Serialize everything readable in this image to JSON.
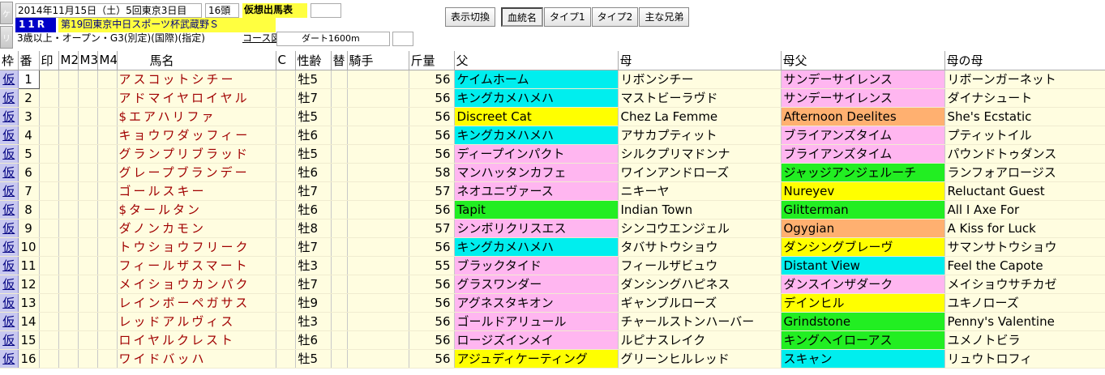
{
  "header": {
    "date": "2014年11月15日（土）5回東京3日目",
    "heads": "16頭",
    "badge": "仮想出馬表",
    "race_no": "11R",
    "race_name": "第19回東京中日スポーツ杯武蔵野Ｓ",
    "conditions": "3歳以上・オープン・G3(別定)(国際)(指定)",
    "course_label": "コース図",
    "course": "ダート1600m"
  },
  "side_buttons": [
    "ケ",
    "リ"
  ],
  "toolbar": {
    "buttons": [
      "表示切換",
      "血統名",
      "タイプ1",
      "タイプ2",
      "主な兄弟"
    ],
    "active_index": 1
  },
  "columns": [
    "枠",
    "番",
    "印",
    "M2",
    "M3",
    "M4",
    "馬名",
    "C",
    "性齢",
    "替",
    "騎手",
    "斤量",
    "父",
    "母",
    "母父",
    "母の母"
  ],
  "colors": {
    "cyan": "#00eeee",
    "pink": "#ffb6f0",
    "yellow": "#ffff00",
    "green": "#22ee22",
    "orange": "#ffb070",
    "row_bg": "#fffde0",
    "waku": "#c8c8f0"
  },
  "rows": [
    {
      "waku": "仮",
      "num": "1",
      "name": "アスコットシチー",
      "sex_age": "牡5",
      "kin": "56",
      "sire": "ケイムホーム",
      "sire_c": "cyan",
      "dam": "リボンシチー",
      "dam_c": "",
      "bms": "サンデーサイレンス",
      "bms_c": "pink",
      "dd": "リボーンガーネット",
      "dd_c": ""
    },
    {
      "waku": "仮",
      "num": "2",
      "name": "アドマイヤロイヤル",
      "sex_age": "牡7",
      "kin": "56",
      "sire": "キングカメハメハ",
      "sire_c": "cyan",
      "dam": "マストビーラヴド",
      "dam_c": "",
      "bms": "サンデーサイレンス",
      "bms_c": "pink",
      "dd": "ダイナシュート",
      "dd_c": ""
    },
    {
      "waku": "仮",
      "num": "3",
      "name": "$エアハリファ",
      "sex_age": "牡5",
      "kin": "56",
      "sire": "Discreet Cat",
      "sire_c": "yellow",
      "dam": "Chez La Femme",
      "dam_c": "",
      "bms": "Afternoon Deelites",
      "bms_c": "orange",
      "dd": "She's Ecstatic",
      "dd_c": ""
    },
    {
      "waku": "仮",
      "num": "4",
      "name": "キョウワダッフィー",
      "sex_age": "牡6",
      "kin": "56",
      "sire": "キングカメハメハ",
      "sire_c": "cyan",
      "dam": "アサカプティット",
      "dam_c": "",
      "bms": "ブライアンズタイム",
      "bms_c": "pink",
      "dd": "プティットイル",
      "dd_c": ""
    },
    {
      "waku": "仮",
      "num": "5",
      "name": "グランプリブラッド",
      "sex_age": "牡5",
      "kin": "56",
      "sire": "ディープインパクト",
      "sire_c": "pink",
      "dam": "シルクプリマドンナ",
      "dam_c": "",
      "bms": "ブライアンズタイム",
      "bms_c": "pink",
      "dd": "パウンドトゥダンス",
      "dd_c": ""
    },
    {
      "waku": "仮",
      "num": "6",
      "name": "グレープブランデー",
      "sex_age": "牡6",
      "kin": "58",
      "sire": "マンハッタンカフェ",
      "sire_c": "pink",
      "dam": "ワインアンドローズ",
      "dam_c": "",
      "bms": "ジャッジアンジェルーチ",
      "bms_c": "green",
      "dd": "ランフォアロージス",
      "dd_c": ""
    },
    {
      "waku": "仮",
      "num": "7",
      "name": "ゴールスキー",
      "sex_age": "牡7",
      "kin": "57",
      "sire": "ネオユニヴァース",
      "sire_c": "pink",
      "dam": "ニキーヤ",
      "dam_c": "",
      "bms": "Nureyev",
      "bms_c": "yellow",
      "dd": "Reluctant Guest",
      "dd_c": ""
    },
    {
      "waku": "仮",
      "num": "8",
      "name": "$タールタン",
      "sex_age": "牡6",
      "kin": "56",
      "sire": "Tapit",
      "sire_c": "green",
      "dam": "Indian Town",
      "dam_c": "",
      "bms": "Glitterman",
      "bms_c": "green",
      "dd": "All I Axe For",
      "dd_c": ""
    },
    {
      "waku": "仮",
      "num": "9",
      "name": "ダノンカモン",
      "sex_age": "牡8",
      "kin": "57",
      "sire": "シンボリクリスエス",
      "sire_c": "pink",
      "dam": "シンコウエンジェル",
      "dam_c": "",
      "bms": "Ogygian",
      "bms_c": "orange",
      "dd": "A Kiss for Luck",
      "dd_c": ""
    },
    {
      "waku": "仮",
      "num": "10",
      "name": "トウショウフリーク",
      "sex_age": "牡7",
      "kin": "56",
      "sire": "キングカメハメハ",
      "sire_c": "cyan",
      "dam": "タバサトウショウ",
      "dam_c": "",
      "bms": "ダンシングブレーヴ",
      "bms_c": "yellow",
      "dd": "サマンサトウショウ",
      "dd_c": ""
    },
    {
      "waku": "仮",
      "num": "11",
      "name": "フィールザスマート",
      "sex_age": "牡3",
      "kin": "55",
      "sire": "ブラックタイド",
      "sire_c": "pink",
      "dam": "フィールザビュウ",
      "dam_c": "",
      "bms": "Distant View",
      "bms_c": "cyan",
      "dd": "Feel the Capote",
      "dd_c": ""
    },
    {
      "waku": "仮",
      "num": "12",
      "name": "メイショウカンパク",
      "sex_age": "牡7",
      "kin": "56",
      "sire": "グラスワンダー",
      "sire_c": "pink",
      "dam": "ダンシングハピネス",
      "dam_c": "",
      "bms": "ダンスインザダーク",
      "bms_c": "pink",
      "dd": "メイショウサチカゼ",
      "dd_c": ""
    },
    {
      "waku": "仮",
      "num": "13",
      "name": "レインボーペガサス",
      "sex_age": "牡9",
      "kin": "56",
      "sire": "アグネスタキオン",
      "sire_c": "pink",
      "dam": "ギャンブルローズ",
      "dam_c": "",
      "bms": "デインヒル",
      "bms_c": "yellow",
      "dd": "ユキノローズ",
      "dd_c": ""
    },
    {
      "waku": "仮",
      "num": "14",
      "name": "レッドアルヴィス",
      "sex_age": "牡3",
      "kin": "56",
      "sire": "ゴールドアリュール",
      "sire_c": "pink",
      "dam": "チャールストンハーバー",
      "dam_c": "",
      "bms": "Grindstone",
      "bms_c": "green",
      "dd": "Penny's Valentine",
      "dd_c": ""
    },
    {
      "waku": "仮",
      "num": "15",
      "name": "ロイヤルクレスト",
      "sex_age": "牡6",
      "kin": "56",
      "sire": "ロージズインメイ",
      "sire_c": "pink",
      "dam": "ルピナスレイク",
      "dam_c": "",
      "bms": "キングヘイローアス",
      "bms_c": "green",
      "dd": "ユメノトビラ",
      "dd_c": ""
    },
    {
      "waku": "仮",
      "num": "16",
      "name": "ワイドバッハ",
      "sex_age": "牡5",
      "kin": "56",
      "sire": "アジュディケーティング",
      "sire_c": "yellow",
      "dam": "グリーンヒルレッド",
      "dam_c": "",
      "bms": "スキャン",
      "bms_c": "cyan",
      "dd": "リュウトロフィ",
      "dd_c": ""
    }
  ]
}
